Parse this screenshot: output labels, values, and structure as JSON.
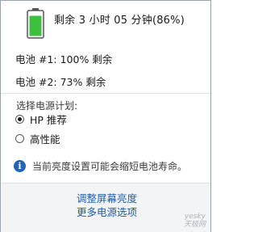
{
  "battery": {
    "summary": "剩余 3 小时 05 分钟(86%)",
    "level_percent": 86,
    "battery1": "电池 #1: 100% 剩余",
    "battery2": "电池 #2: 73% 剩余"
  },
  "power_plan": {
    "title": "选择电源计划:",
    "options": [
      {
        "label": "HP 推荐",
        "selected": true
      },
      {
        "label": "高性能",
        "selected": false
      }
    ]
  },
  "info": {
    "icon": "info-icon",
    "text": "当前亮度设置可能会缩短电池寿命。"
  },
  "links": {
    "adjust_brightness": "调整屏幕亮度",
    "more_options": "更多电源选项"
  },
  "watermark": {
    "line1": "yesky",
    "line2": "天极网"
  },
  "colors": {
    "battery_green": "#3fbf3f",
    "link_blue": "#1e5fae",
    "info_blue": "#1e66b8"
  }
}
